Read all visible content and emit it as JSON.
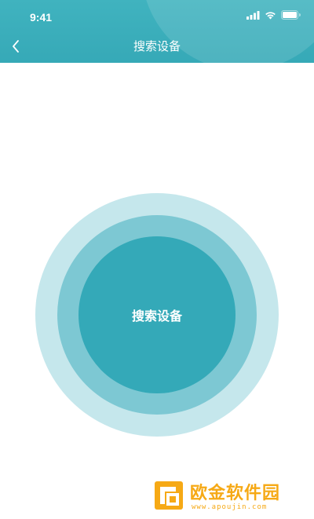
{
  "status_bar": {
    "time": "9:41",
    "icons": [
      "signal-icon",
      "wifi-icon",
      "battery-icon"
    ]
  },
  "nav_bar": {
    "back_icon": "chevron-left-icon",
    "title": "搜索设备"
  },
  "radar": {
    "button_label": "搜索设备"
  },
  "watermark": {
    "text": "欧金软件园",
    "url": "www.apoujin.com"
  },
  "colors": {
    "header": "#3aaebb",
    "ring_outer": "#c5e7ec",
    "ring_middle": "#7dc8d3",
    "button": "#34a9b8",
    "watermark": "#f6a915"
  }
}
